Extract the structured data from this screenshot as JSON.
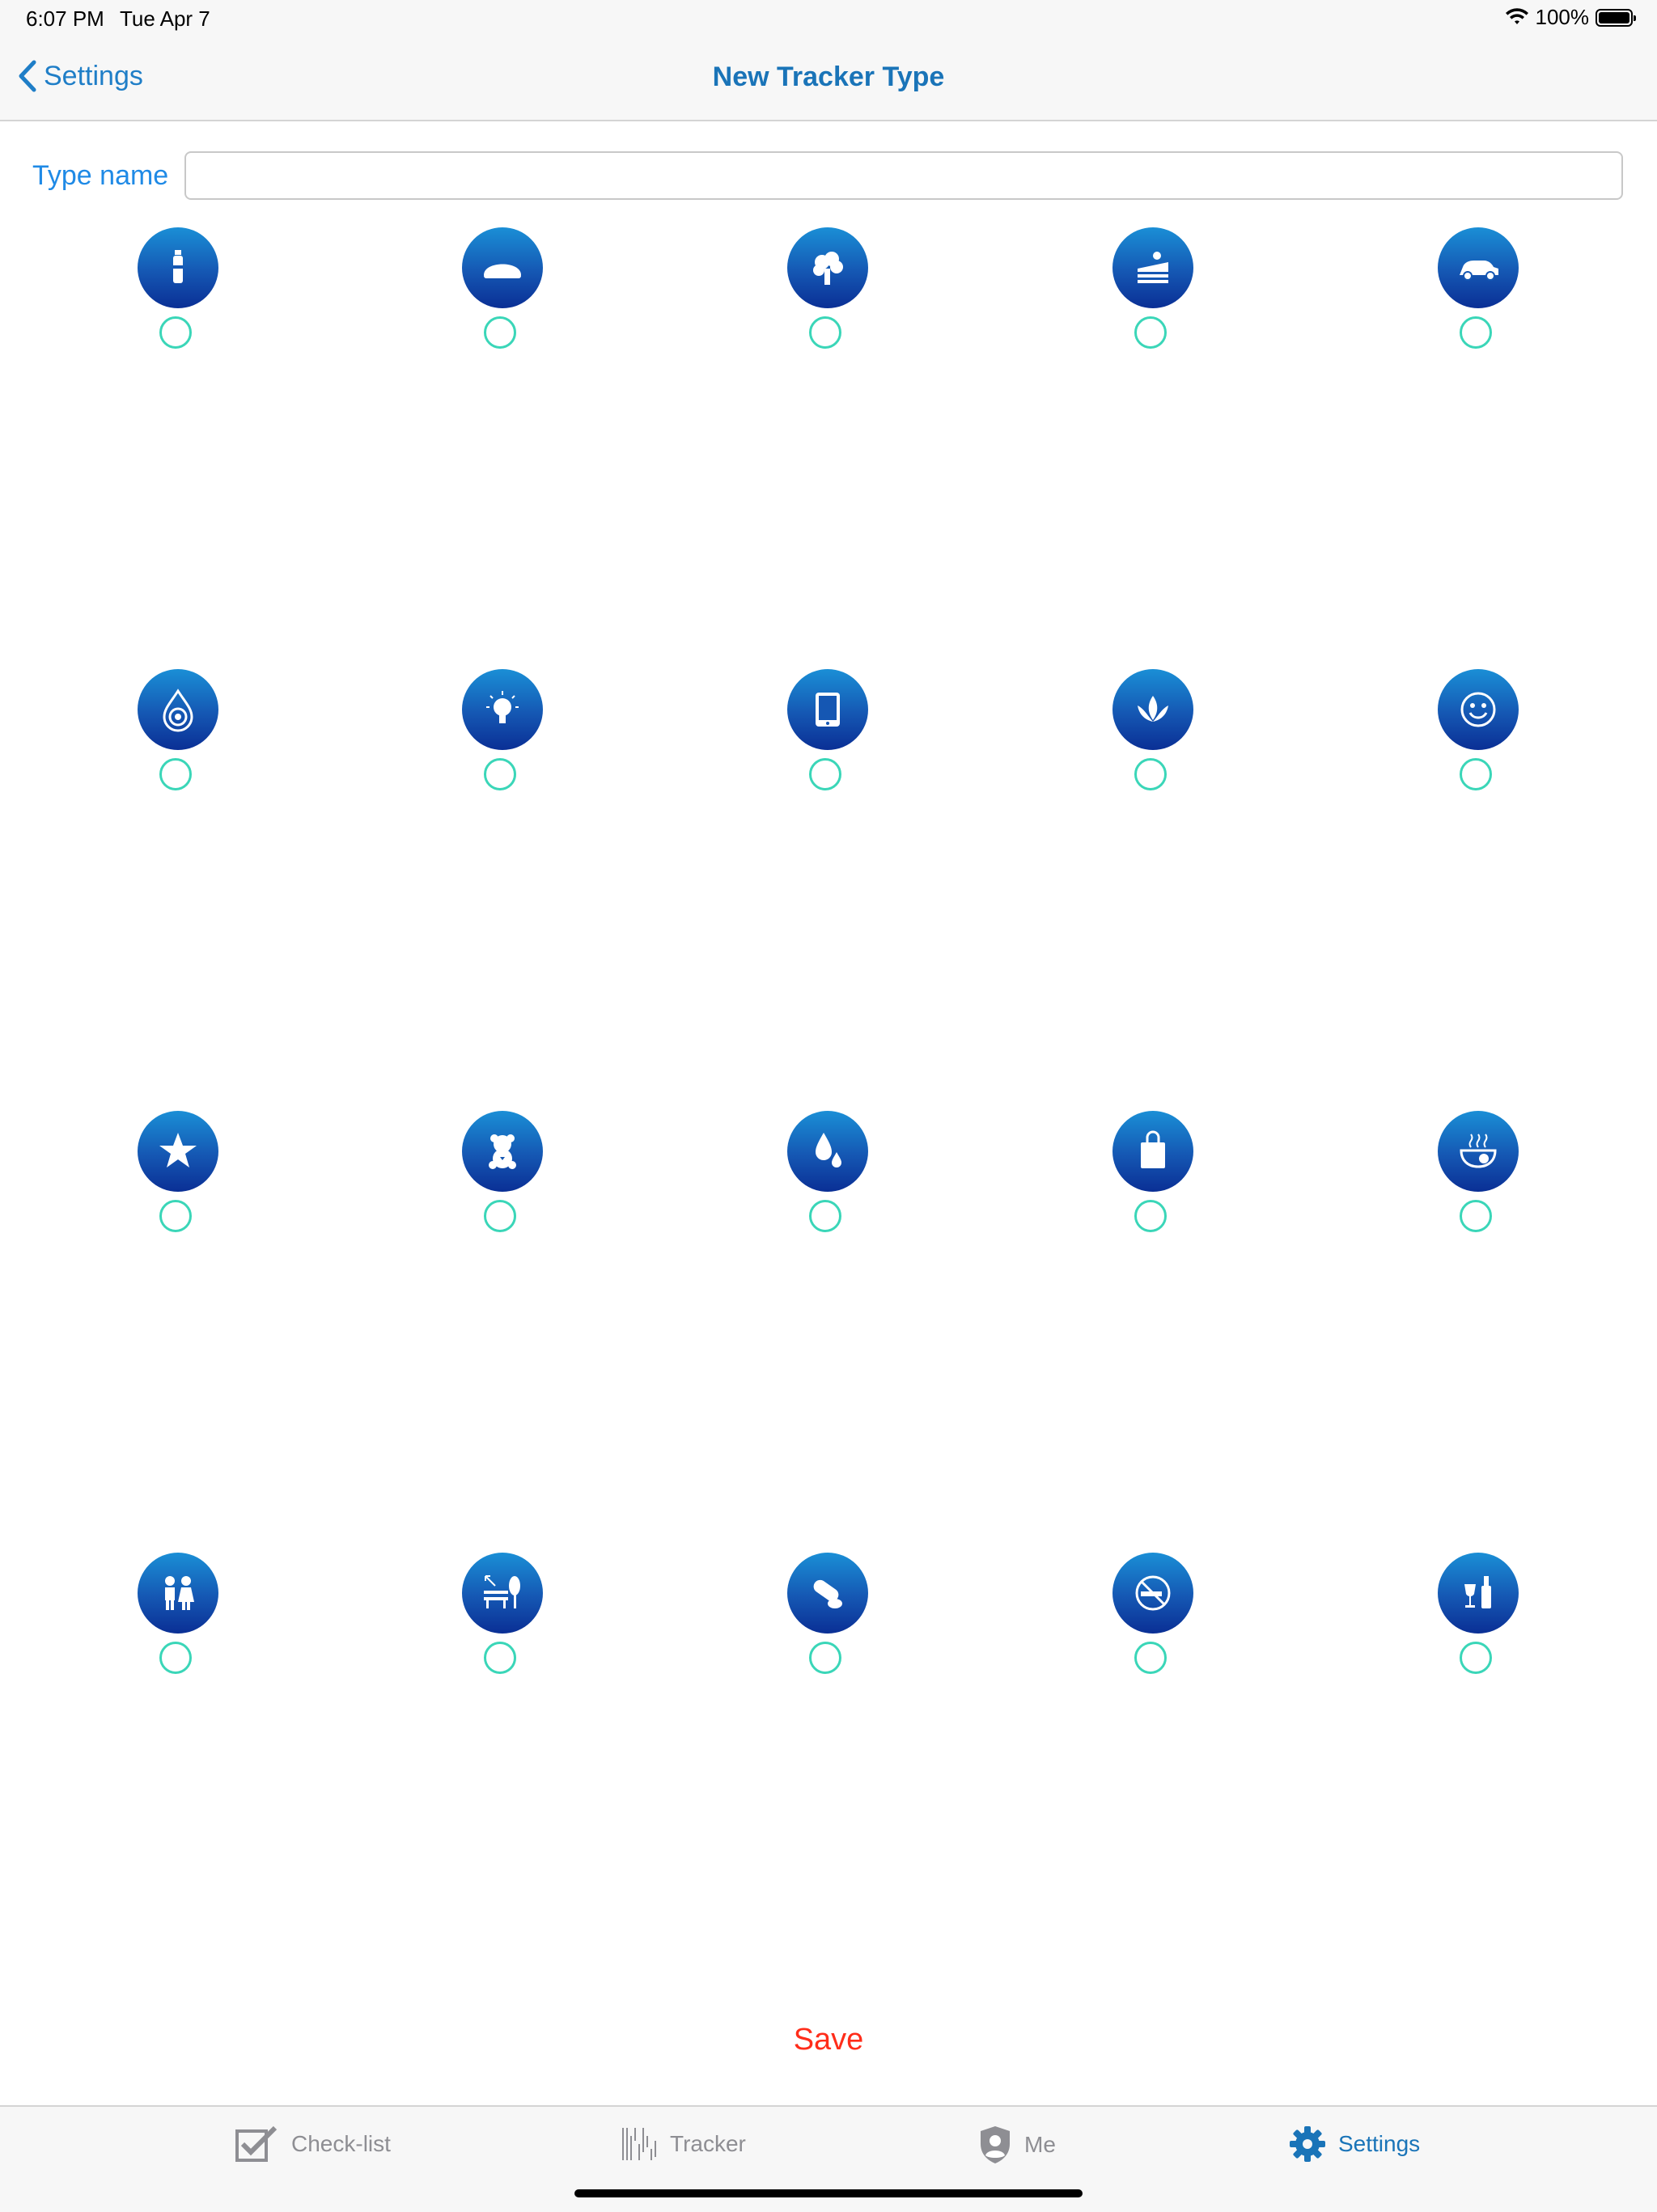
{
  "status_bar": {
    "time": "6:07 PM",
    "date": "Tue Apr 7",
    "battery": "100%"
  },
  "nav": {
    "back_label": "Settings",
    "title": "New Tracker Type"
  },
  "form": {
    "type_name_label": "Type name",
    "type_name_value": "",
    "type_name_placeholder": ""
  },
  "icons": [
    [
      "bottle-icon",
      "bread-icon",
      "broccoli-icon",
      "cake-icon",
      "car-icon"
    ],
    [
      "water-ripple-icon",
      "lightbulb-icon",
      "tablet-icon",
      "lotus-icon",
      "smiley-icon"
    ],
    [
      "star-icon",
      "teddy-bear-icon",
      "water-drops-icon",
      "shopping-bag-icon",
      "hot-meal-icon"
    ],
    [
      "kids-icon",
      "park-bench-icon",
      "pills-icon",
      "no-smoking-icon",
      "wine-icon"
    ]
  ],
  "actions": {
    "save_label": "Save"
  },
  "tabs": [
    {
      "label": "Check-list",
      "icon": "checklist-icon"
    },
    {
      "label": "Tracker",
      "icon": "tracker-icon"
    },
    {
      "label": "Me",
      "icon": "shield-user-icon"
    },
    {
      "label": "Settings",
      "icon": "gear-icon",
      "active": true
    }
  ],
  "colors": {
    "accent": "#1a74b8",
    "save": "#ff2d1a",
    "radio": "#3ad6b8",
    "icon_top": "#1a8fd6",
    "icon_bottom": "#0a2f95"
  }
}
